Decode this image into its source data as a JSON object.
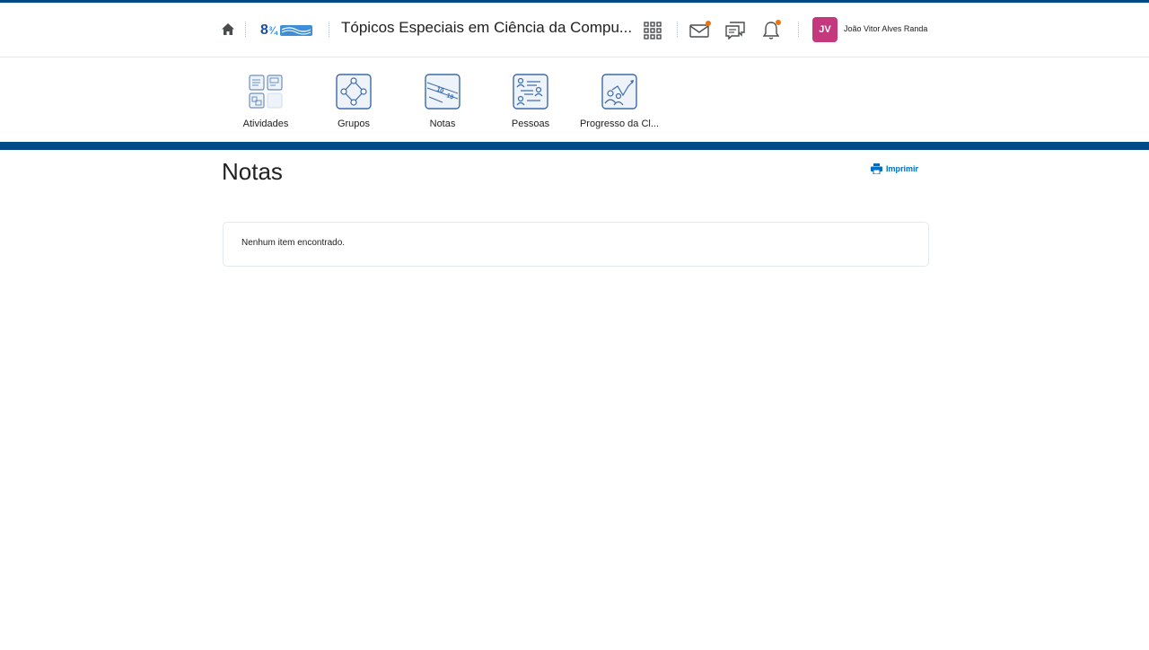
{
  "header": {
    "home_icon": "home-icon",
    "logo_alt": "8¾ Anchieta",
    "course_title": "Tópicos Especiais em Ciência da Compu...",
    "icons": [
      "apps-grid-icon",
      "mail-icon",
      "chat-icon",
      "bell-icon"
    ],
    "mail_has_notification": true,
    "bell_has_notification": true,
    "user_initials": "JV",
    "user_name": "João Vitor Alves Randa",
    "avatar_color": "#c4387d",
    "notification_color": "#e87511"
  },
  "nav": {
    "items": [
      {
        "label": "Atividades",
        "icon": "activities-icon"
      },
      {
        "label": "Grupos",
        "icon": "groups-icon"
      },
      {
        "label": "Notas",
        "icon": "grades-icon"
      },
      {
        "label": "Pessoas",
        "icon": "people-icon"
      },
      {
        "label": "Progresso da Cl...",
        "icon": "class-progress-icon"
      }
    ]
  },
  "main": {
    "title": "Notas",
    "print_label": "Imprimir",
    "empty_message": "Nenhum item encontrado."
  },
  "theme": {
    "brand_blue": "#004b87",
    "link_blue": "#006fbf"
  }
}
